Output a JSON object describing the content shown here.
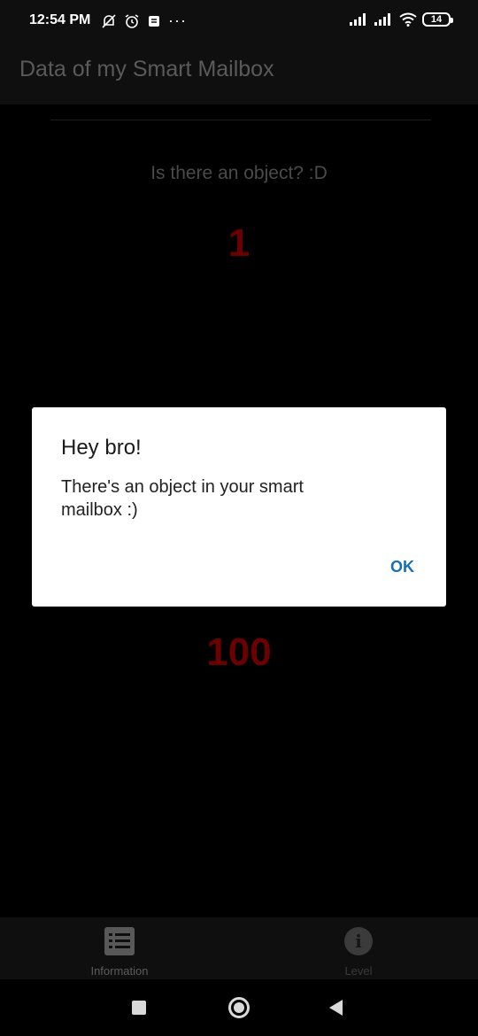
{
  "status_bar": {
    "time": "12:54 PM",
    "battery": "14",
    "icons_left": [
      "mute-icon",
      "alarm-icon",
      "notification-icon",
      "more-dots-icon"
    ],
    "icons_right": [
      "signal-icon",
      "signal-icon",
      "wifi-icon",
      "battery-icon"
    ]
  },
  "app_bar": {
    "title": "Data of my Smart Mailbox"
  },
  "content": {
    "question": "Is there an object? :D",
    "object_value": "1",
    "level_value": "100"
  },
  "dialog": {
    "title": "Hey bro!",
    "message": "There's an object in  your smart mailbox :)",
    "ok_label": "OK"
  },
  "bottom_nav": {
    "items": [
      {
        "label": "Information",
        "icon": "list-icon",
        "active": true
      },
      {
        "label": "Level",
        "icon": "info-icon",
        "active": false
      }
    ]
  },
  "colors": {
    "accent_red": "#6a0000",
    "dialog_button": "#1a6fb0"
  }
}
